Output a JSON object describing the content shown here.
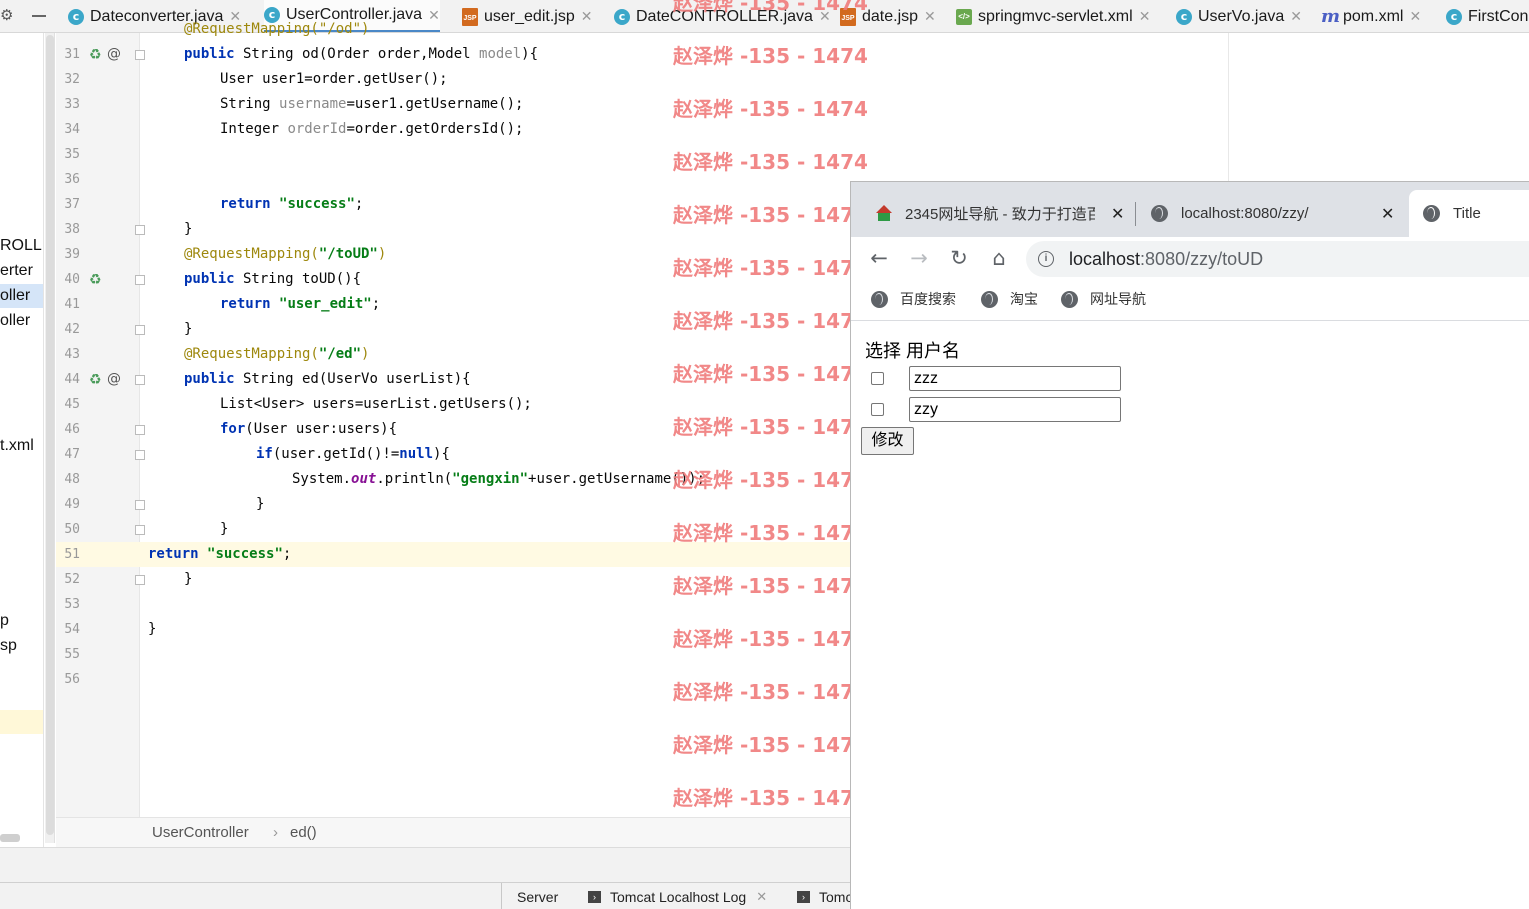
{
  "ide": {
    "tabs": [
      {
        "label": "Dateconverter.java",
        "icon": "java-class-icon",
        "active": false
      },
      {
        "label": "UserController.java",
        "icon": "java-class-icon",
        "active": true
      },
      {
        "label": "user_edit.jsp",
        "icon": "jsp-file-icon",
        "active": false
      },
      {
        "label": "DateCONTROLLER.java",
        "icon": "java-class-icon",
        "active": false
      },
      {
        "label": "date.jsp",
        "icon": "jsp-file-icon",
        "active": false
      },
      {
        "label": "springmvc-servlet.xml",
        "icon": "xml-file-icon",
        "active": false
      },
      {
        "label": "UserVo.java",
        "icon": "java-class-icon",
        "active": false
      },
      {
        "label": "pom.xml",
        "icon": "maven-icon",
        "active": false
      },
      {
        "label": "FirstCon",
        "icon": "java-class-icon",
        "active": false
      }
    ],
    "class_icon_glyph": "c",
    "jsp_icon_glyph": "JSP",
    "xml_icon_glyph": "</>",
    "maven_icon_glyph": "m",
    "project_tree": [
      "ROLLER",
      "erter",
      "oller",
      "oller",
      "t.xml",
      "p",
      "sp"
    ],
    "line_numbers": [
      "31",
      "32",
      "33",
      "34",
      "35",
      "36",
      "37",
      "38",
      "39",
      "40",
      "41",
      "42",
      "43",
      "44",
      "45",
      "46",
      "47",
      "48",
      "49",
      "50",
      "51",
      "52",
      "53",
      "54",
      "55",
      "56"
    ],
    "code": {
      "l30_partial": "@RequestMapping(\"/od\")",
      "l31": [
        "public",
        " String od(Order order,Model ",
        "model",
        "){"
      ],
      "l32": "User user1=order.getUser();",
      "l33": [
        "String ",
        "username",
        "=user1.getUsername();"
      ],
      "l34": [
        "Integer ",
        "orderId",
        "=order.getOrdersId();"
      ],
      "l37": [
        "return",
        " ",
        "\"success\"",
        ";"
      ],
      "l38": "}",
      "l39": [
        "@RequestMapping(",
        "\"/toUD\"",
        ")"
      ],
      "l40": [
        "public",
        " String toUD(){"
      ],
      "l41": [
        "return",
        " ",
        "\"user_edit\"",
        ";"
      ],
      "l42": "}",
      "l43": [
        "@RequestMapping(",
        "\"/ed\"",
        ")"
      ],
      "l44": [
        "public",
        " String ed(UserVo userList){"
      ],
      "l45": "List<User> users=userList.getUsers();",
      "l46": [
        "for",
        "(User user:users){"
      ],
      "l47": [
        "if",
        "(user.getId()!=",
        "null",
        "){"
      ],
      "l48": [
        "System.",
        "out",
        ".println(",
        "\"gengxin\"",
        "+user.getUsername());"
      ],
      "l49": "}",
      "l50": "}",
      "l51": [
        "return",
        " ",
        "\"success\"",
        ";"
      ],
      "l52": "}",
      "l54": "}"
    },
    "watermark": "赵泽烨 -135 - 1474",
    "breadcrumb": [
      "UserController",
      "ed()"
    ],
    "breadcrumb_sep": "›",
    "bottom_tabs": [
      "Server",
      "Tomcat Localhost Log",
      "Tomc"
    ]
  },
  "browser": {
    "tabs": [
      {
        "title": "2345网址导航 - 致力于打造百",
        "icon": "house-icon",
        "active": false
      },
      {
        "title": "localhost:8080/zzy/",
        "icon": "globe-icon",
        "active": false
      },
      {
        "title": "Title",
        "icon": "globe-icon",
        "active": true
      }
    ],
    "close_glyph": "✕",
    "address": {
      "host": "localhost",
      "path": ":8080/zzy/toUD"
    },
    "bookmarks": [
      "百度搜索",
      "淘宝",
      "网址导航"
    ],
    "page": {
      "heading": "选择 用户名",
      "rows": [
        {
          "checked": false,
          "username": "zzz"
        },
        {
          "checked": false,
          "username": "zzy"
        }
      ],
      "submit_label": "修改"
    }
  }
}
